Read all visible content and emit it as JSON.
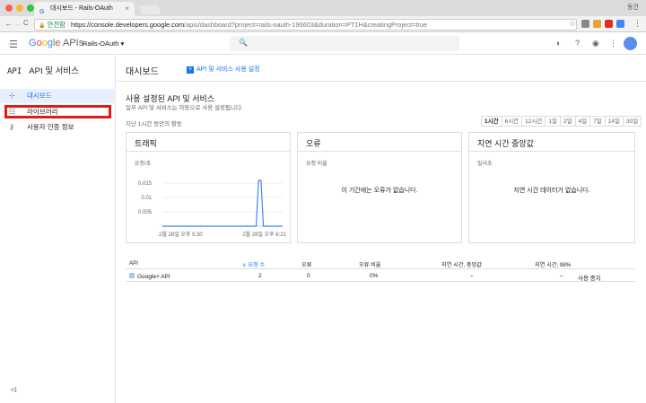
{
  "browser": {
    "tab_title": "대시보드 - Rails-OAuth",
    "tab_favicon": "G",
    "tab_close": "×",
    "user": "동건",
    "secure_label": "안전함",
    "url_host": "https://console.developers.google.com",
    "url_rest": "/apis/dashboard?project=rails-oauth-196603&duration=PT1H&creatingProject=true",
    "back_glyph": "←",
    "forward_glyph": "→",
    "reload_glyph": "C",
    "star_glyph": "☆",
    "lock_glyph": "🔒"
  },
  "header": {
    "menu_glyph": "☰",
    "logo_g": "G",
    "logo_o1": "o",
    "logo_o2": "o",
    "logo_g2": "g",
    "logo_l": "l",
    "logo_e": "e",
    "logo_apis": "APIs",
    "project": "Rails-OAuth ▾",
    "search_glyph": "🔍"
  },
  "nav": {
    "badge": "API",
    "title": "API 및 서비스",
    "items": [
      {
        "label": "대시보드",
        "icon": "⊹"
      },
      {
        "label": "라이브러리",
        "icon": "☷"
      },
      {
        "label": "사용자 인증 정보",
        "icon": "⚷"
      }
    ],
    "collapse": "<I"
  },
  "main": {
    "page_title": "대시보드",
    "enable_label": "API 및 서비스 사용 설정",
    "enable_plus": "+",
    "section_title": "사용 설정된 API 및 서비스",
    "section_desc": "일부 API 및 서비스는 자동으로 사용 설정됩니다.",
    "period_label": "지난 1시간 동안의 활동",
    "time_ranges": [
      "1시간",
      "6시간",
      "12시간",
      "1일",
      "2일",
      "4일",
      "7일",
      "14일",
      "30일"
    ],
    "selected_range": "1시간"
  },
  "cards": {
    "traffic": {
      "title": "트래픽",
      "sub": "요청/초"
    },
    "errors": {
      "title": "오류",
      "sub": "요청 비율",
      "empty": "이 기간에는 오류가 없습니다."
    },
    "latency": {
      "title": "지연 시간 중앙값",
      "sub": "밀리초",
      "empty": "지연 시간 데이터가 없습니다."
    }
  },
  "chart_data": {
    "type": "line",
    "title": "트래픽",
    "ylabel": "요청/초",
    "yticks": [
      "0.015",
      "0.01",
      "0.005"
    ],
    "ylim": [
      0,
      0.02
    ],
    "xticks": [
      "2월 28일 오후 5:30",
      "2월 28일 오후 6:21"
    ],
    "series": [
      {
        "x": [
          0,
          0.78,
          0.8,
          0.82,
          0.84,
          1.0
        ],
        "values": [
          0,
          0,
          0.016,
          0.016,
          0,
          0
        ]
      }
    ],
    "color": "#4285f4"
  },
  "table": {
    "headers": [
      "API",
      "요청 수",
      "오류",
      "오류 비율",
      "지연 시간, 중앙값",
      "지연 시간, 98%"
    ],
    "sort_glyph": "∨",
    "rows": [
      {
        "api": "Google+ API",
        "requests": "2",
        "errors": "0",
        "error_ratio": "0%",
        "latency_median": "–",
        "latency_98": "–",
        "action": "사용 중지"
      }
    ]
  }
}
